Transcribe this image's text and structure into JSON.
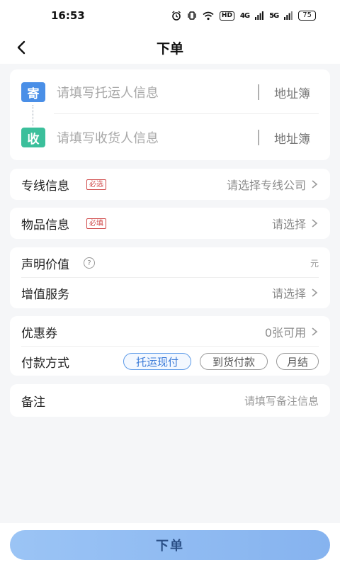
{
  "status_bar": {
    "time": "16:53",
    "hd_badge": "HD",
    "signal_1": "4G",
    "signal_2": "5G",
    "battery": "75"
  },
  "nav": {
    "title": "下单",
    "back_icon": "chevron-left-icon"
  },
  "address": {
    "sender_tag": "寄",
    "sender_placeholder": "请填写托运人信息",
    "sender_book": "地址簿",
    "receiver_tag": "收",
    "receiver_placeholder": "请填写收货人信息",
    "receiver_book": "地址簿",
    "sender_color": "#4a8fe7",
    "receiver_color": "#3bbf9b"
  },
  "line_info": {
    "label": "专线信息",
    "required": "必选",
    "value": "请选择专线公司"
  },
  "goods_info": {
    "label": "物品信息",
    "required": "必填",
    "value": "请选择"
  },
  "declared_value": {
    "label": "声明价值",
    "help_icon": "question-icon",
    "unit": "元"
  },
  "value_added": {
    "label": "增值服务",
    "value": "请选择"
  },
  "coupon": {
    "label": "优惠券",
    "value": "0张可用"
  },
  "payment": {
    "label": "付款方式",
    "options": [
      "托运现付",
      "到货付款",
      "月结"
    ],
    "selected": "托运现付"
  },
  "remark": {
    "label": "备注",
    "placeholder": "请填写备注信息"
  },
  "submit": {
    "label": "下单"
  },
  "colors": {
    "accent": "#3a7ad8",
    "required": "#d04a4a",
    "button_bg": "#8fbaf2"
  }
}
